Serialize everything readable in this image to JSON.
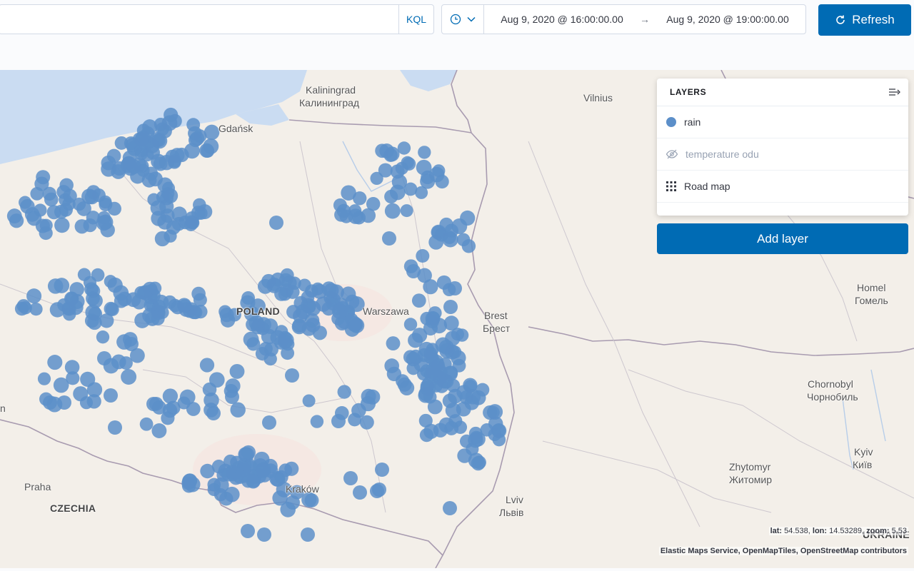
{
  "query": {
    "placeholder": "",
    "language_label": "KQL"
  },
  "time": {
    "start": "Aug 9, 2020 @ 16:00:00.00",
    "arrow": "→",
    "end": "Aug 9, 2020 @ 19:00:00.00"
  },
  "refresh_label": "Refresh",
  "layers": {
    "title": "LAYERS",
    "items": [
      {
        "label": "rain",
        "icon": "circle-icon",
        "visible": true
      },
      {
        "label": "temperature odu",
        "icon": "eye-closed-icon",
        "visible": false
      },
      {
        "label": "Road map",
        "icon": "grid-icon",
        "visible": true
      }
    ],
    "add_label": "Add layer"
  },
  "map": {
    "labels": {
      "kaliningrad": "Kaliningrad",
      "kaliningrad_ru": "Калининград",
      "vilnius": "Vilnius",
      "gdansk": "Gdańsk",
      "poland": "POLAND",
      "warszawa": "Warszawa",
      "brest": "Brest",
      "brest_ru": "Брест",
      "homel": "Homel",
      "homel_ru": "Гомель",
      "chornobyl": "Chornobyl",
      "chornobyl_ru": "Чорнобиль",
      "zhytomyr": "Zhytomyr",
      "zhytomyr_ru": "Житомир",
      "kyiv": "Kyiv",
      "kyiv_ru": "Київ",
      "lviv": "Lviv",
      "lviv_ru": "Львів",
      "krakow": "Kraków",
      "praha": "Praha",
      "czechia": "CZECHIA",
      "ukraine": "UKRAINE",
      "edge_n": "n"
    },
    "coords": {
      "lat_label": "lat:",
      "lat": "54.538,",
      "lon_label": "lon:",
      "lon": "14.53289,",
      "zoom_label": "zoom:",
      "zoom": "5.53"
    },
    "attribution": "Elastic Maps Service, OpenMapTiles, OpenStreetMap contributors",
    "point_color": "#5c8fc9"
  }
}
